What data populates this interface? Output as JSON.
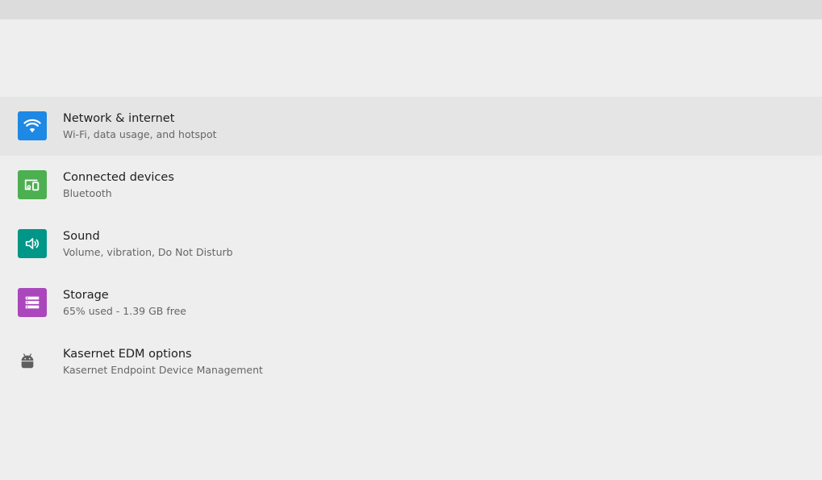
{
  "colors": {
    "network": "#1e88e5",
    "connected": "#4caf50",
    "sound": "#009688",
    "storage": "#9c27b0",
    "edm": "#5f5f5f"
  },
  "settings": {
    "items": [
      {
        "title": "Network & internet",
        "subtitle": "Wi-Fi, data usage, and hotspot",
        "icon": "wifi-icon"
      },
      {
        "title": "Connected devices",
        "subtitle": "Bluetooth",
        "icon": "devices-icon"
      },
      {
        "title": "Sound",
        "subtitle": "Volume, vibration, Do Not Disturb",
        "icon": "speaker-icon"
      },
      {
        "title": "Storage",
        "subtitle": "65% used - 1.39 GB free",
        "icon": "storage-icon"
      },
      {
        "title": "Kasernet EDM options",
        "subtitle": "Kasernet Endpoint Device Management",
        "icon": "android-icon"
      }
    ]
  }
}
